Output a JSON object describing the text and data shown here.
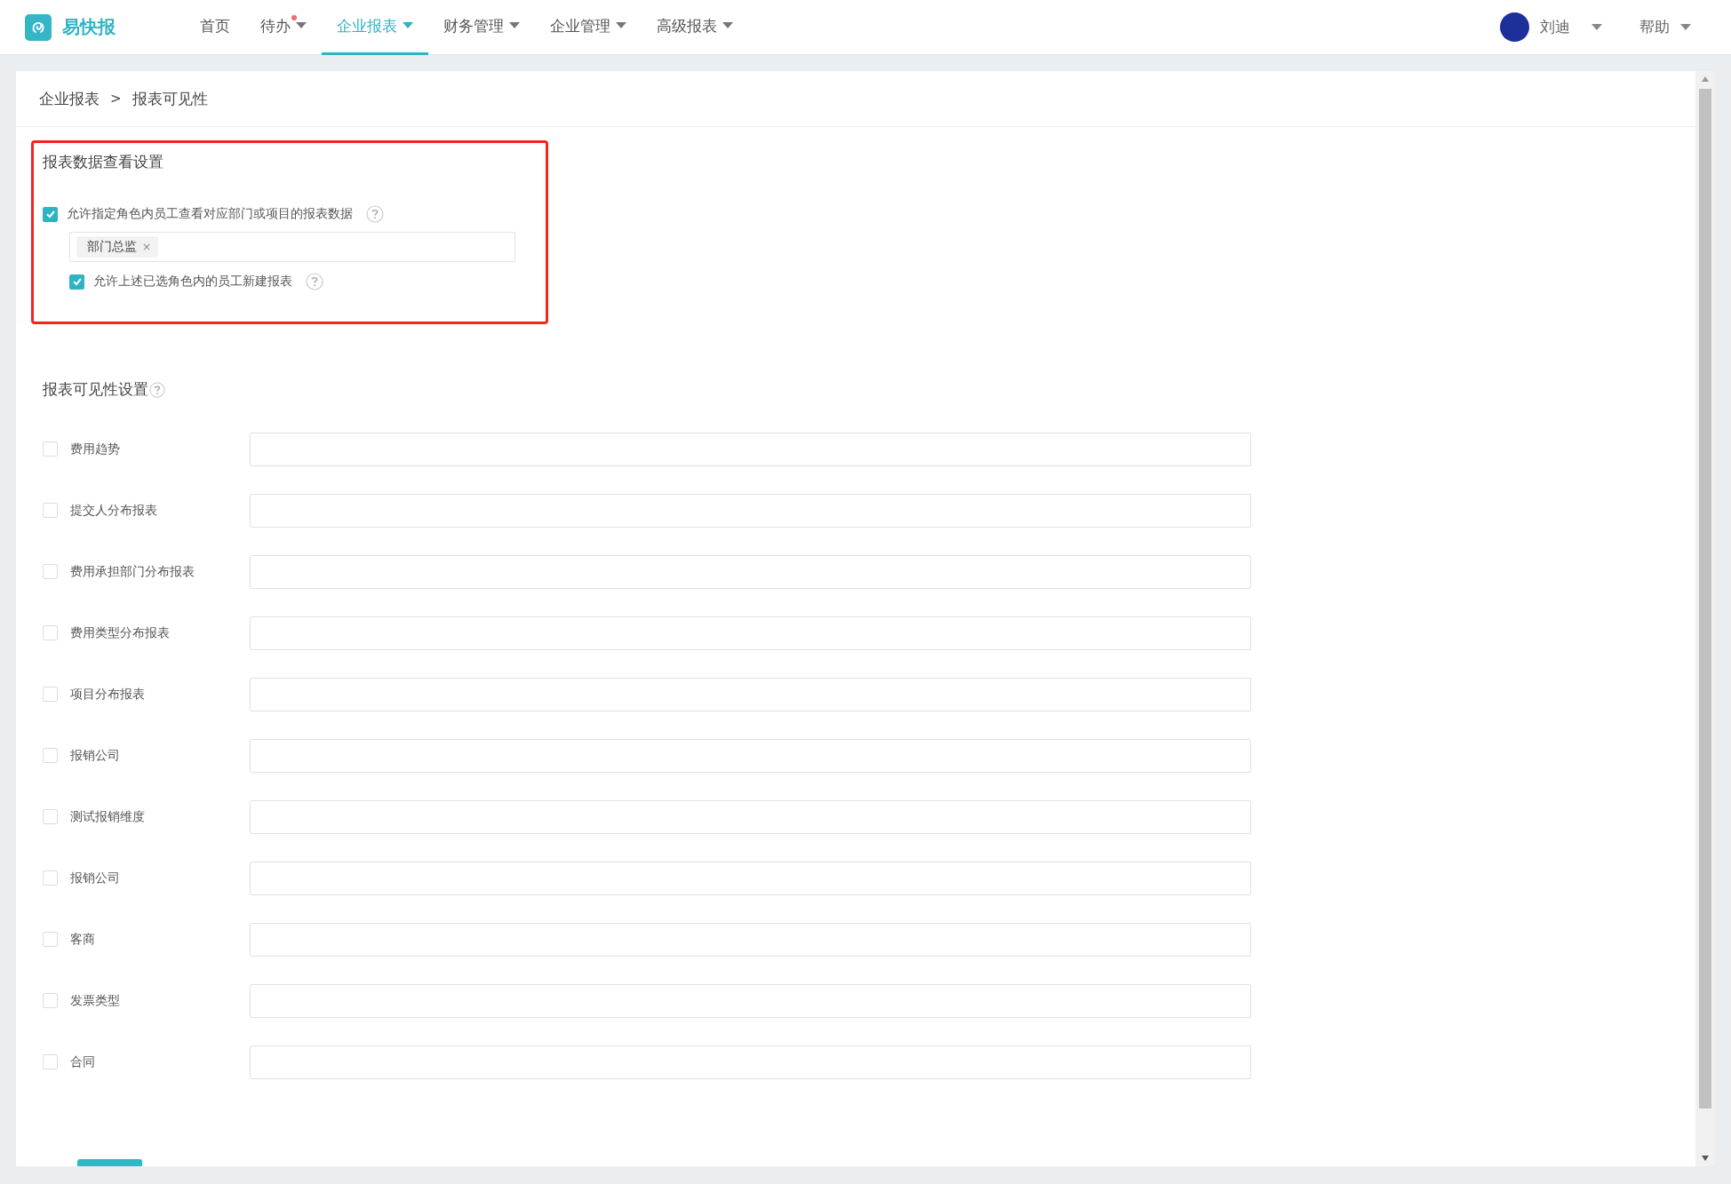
{
  "brand": "易快报",
  "nav": [
    {
      "label": "首页",
      "selected": false,
      "has_menu": false,
      "badge": false
    },
    {
      "label": "待办",
      "selected": false,
      "has_menu": true,
      "badge": true
    },
    {
      "label": "企业报表",
      "selected": true,
      "has_menu": true,
      "badge": false
    },
    {
      "label": "财务管理",
      "selected": false,
      "has_menu": true,
      "badge": false
    },
    {
      "label": "企业管理",
      "selected": false,
      "has_menu": true,
      "badge": false
    },
    {
      "label": "高级报表",
      "selected": false,
      "has_menu": true,
      "badge": false
    }
  ],
  "user": {
    "name": "刘迪"
  },
  "help": {
    "label": "帮助"
  },
  "breadcrumb": {
    "items": [
      "企业报表",
      "报表可见性"
    ],
    "separator": ">"
  },
  "data_view_settings": {
    "title": "报表数据查看设置",
    "highlighted": true,
    "allow_view": {
      "label": "允许指定角色内员工查看对应部门或项目的报表数据",
      "checked": true
    },
    "roles": [
      {
        "label": "部门总监",
        "remove": "×"
      }
    ],
    "allow_create": {
      "label": "允许上述已选角色内的员工新建报表",
      "checked": true
    }
  },
  "visibility_settings": {
    "title": "报表可见性设置",
    "items": [
      {
        "label": "费用趋势",
        "checked": false
      },
      {
        "label": "提交人分布报表",
        "checked": false
      },
      {
        "label": "费用承担部门分布报表",
        "checked": false
      },
      {
        "label": "费用类型分布报表",
        "checked": false
      },
      {
        "label": "项目分布报表",
        "checked": false
      },
      {
        "label": "报销公司",
        "checked": false
      },
      {
        "label": "测试报销维度",
        "checked": false
      },
      {
        "label": "报销公司",
        "checked": false
      },
      {
        "label": "客商",
        "checked": false
      },
      {
        "label": "发票类型",
        "checked": false
      },
      {
        "label": "合同",
        "checked": false
      }
    ]
  }
}
